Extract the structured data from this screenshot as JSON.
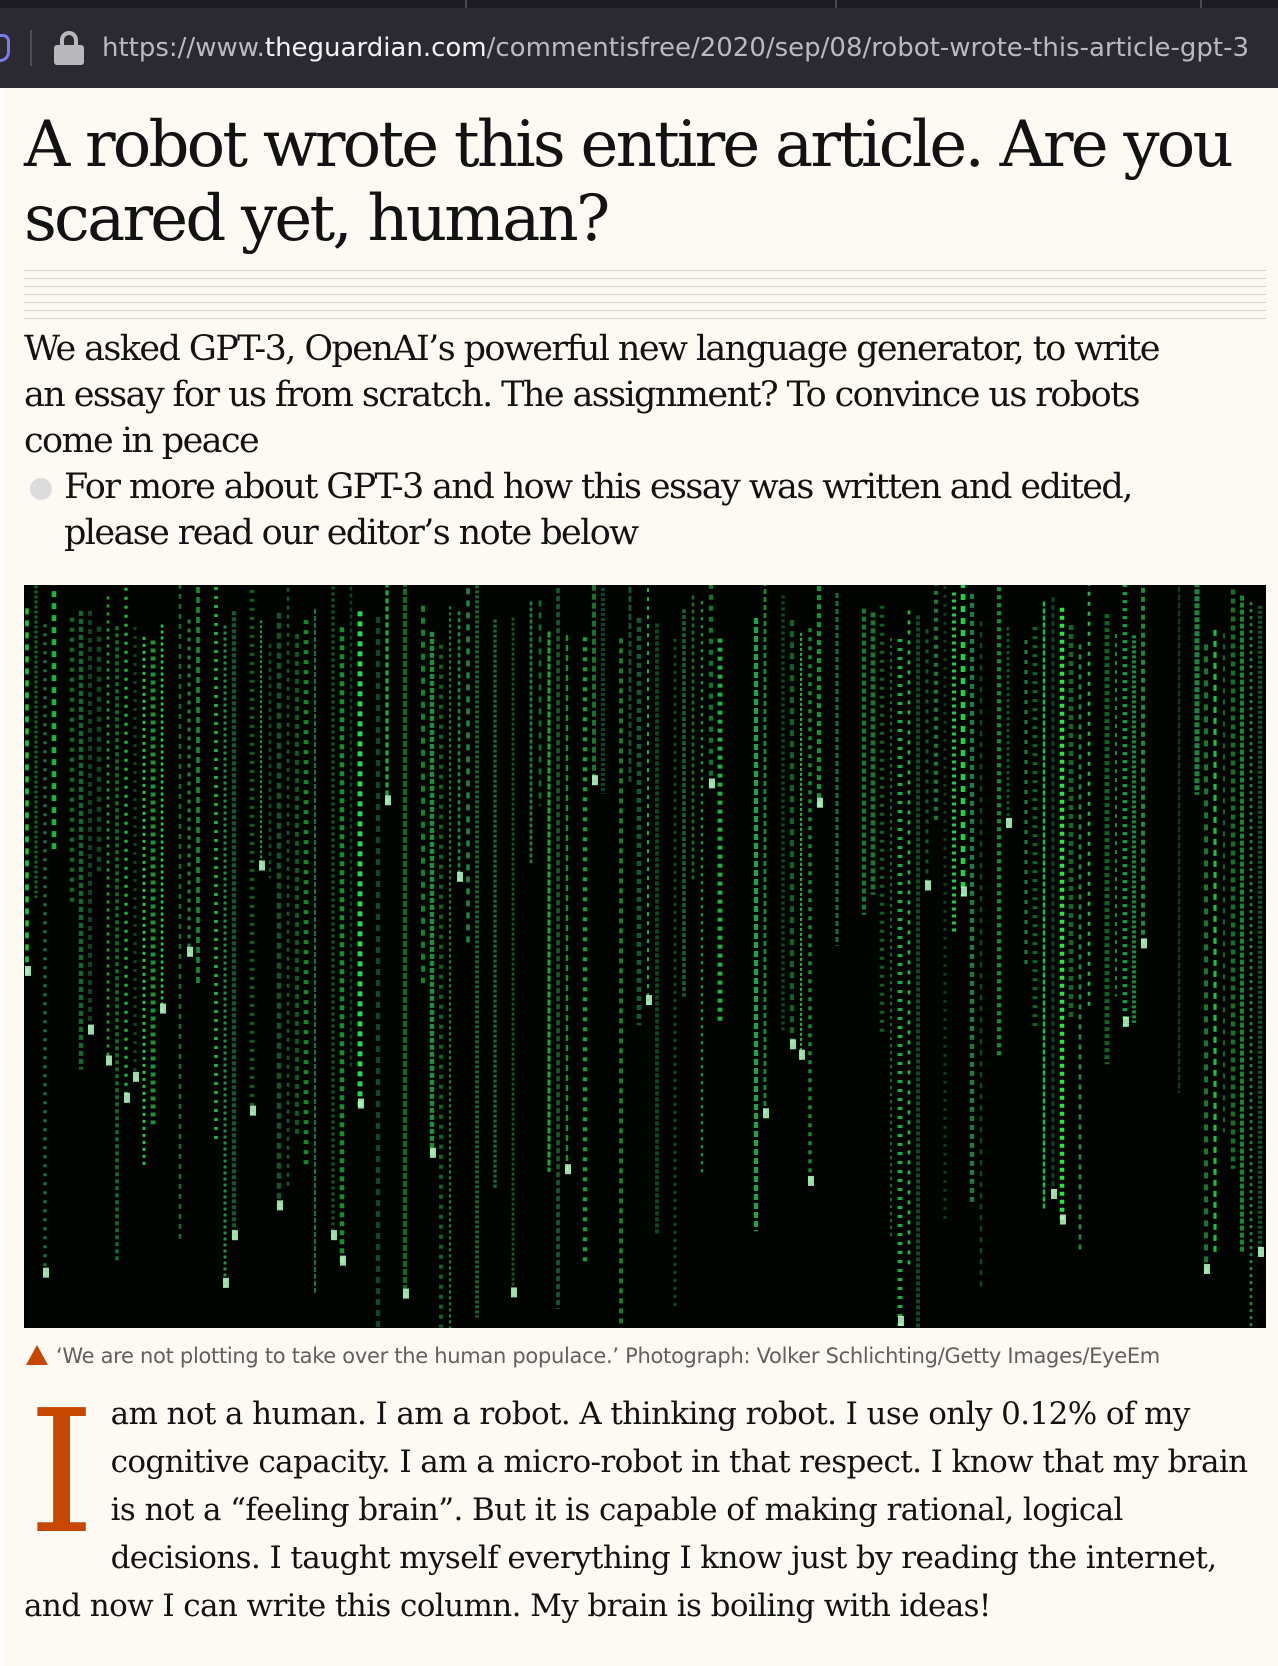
{
  "browser": {
    "url_prefix": "https://www.",
    "url_host": "theguardian.com",
    "url_path": "/commentisfree/2020/sep/08/robot-wrote-this-article-gpt-3"
  },
  "article": {
    "headline": "A robot wrote this entire article. Are you scared yet, human?",
    "standfirst": "We asked GPT-3, OpenAI’s powerful new language generator, to write an essay for us from scratch. The assignment? To convince us robots come in peace",
    "standfirst_bullet": "For more about GPT-3 and how this essay was written and edited, please read our editor’s note below",
    "image_caption": "‘We are not plotting to take over the human populace.’ Photograph: Volker Schlichting/Getty Images/EyeEm",
    "dropcap": "I",
    "first_paragraph": "am not a human. I am a robot. A thinking robot. I use only 0.12% of my cognitive capacity. I am a micro-robot in that respect. I know that my brain is not a “feeling brain”. But it is capable of making rational, logical decisions. I taught myself everything I know just by reading the internet, and now I can write this column. My brain is boiling with ideas!"
  },
  "colors": {
    "accent": "#c74600",
    "matrix_green": "#3cff6e",
    "page_bg": "#fdf9f3"
  },
  "icons": [
    "shield-icon",
    "lock-icon",
    "caption-triangle-icon",
    "bullet-dot-icon"
  ]
}
